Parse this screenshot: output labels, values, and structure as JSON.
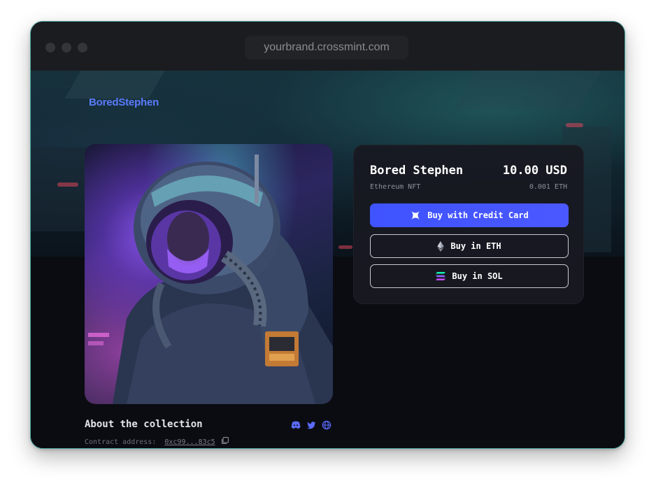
{
  "browser": {
    "url": "yourbrand.crossmint.com"
  },
  "brand": {
    "name": "BoredStephen"
  },
  "product": {
    "title": "Bored Stephen",
    "price": "10.00 USD",
    "subtitle": "Ethereum NFT",
    "crypto_price": "0.001 ETH"
  },
  "buttons": {
    "credit_card": "Buy with Credit Card",
    "eth": "Buy in ETH",
    "sol": "Buy in SOL"
  },
  "collection": {
    "heading": "About the collection",
    "contract_label": "Contract address:",
    "contract_address": "0xc99...83c5"
  },
  "icons": {
    "credit_card": "crossmint-x-icon",
    "eth": "ethereum-icon",
    "sol": "solana-icon",
    "discord": "discord-icon",
    "twitter": "twitter-icon",
    "globe": "globe-icon",
    "copy": "copy-icon"
  },
  "colors": {
    "brand": "#5b7cff",
    "primary_button": "#4050ff",
    "card_bg": "#181921",
    "page_bg": "#0b0c12"
  }
}
